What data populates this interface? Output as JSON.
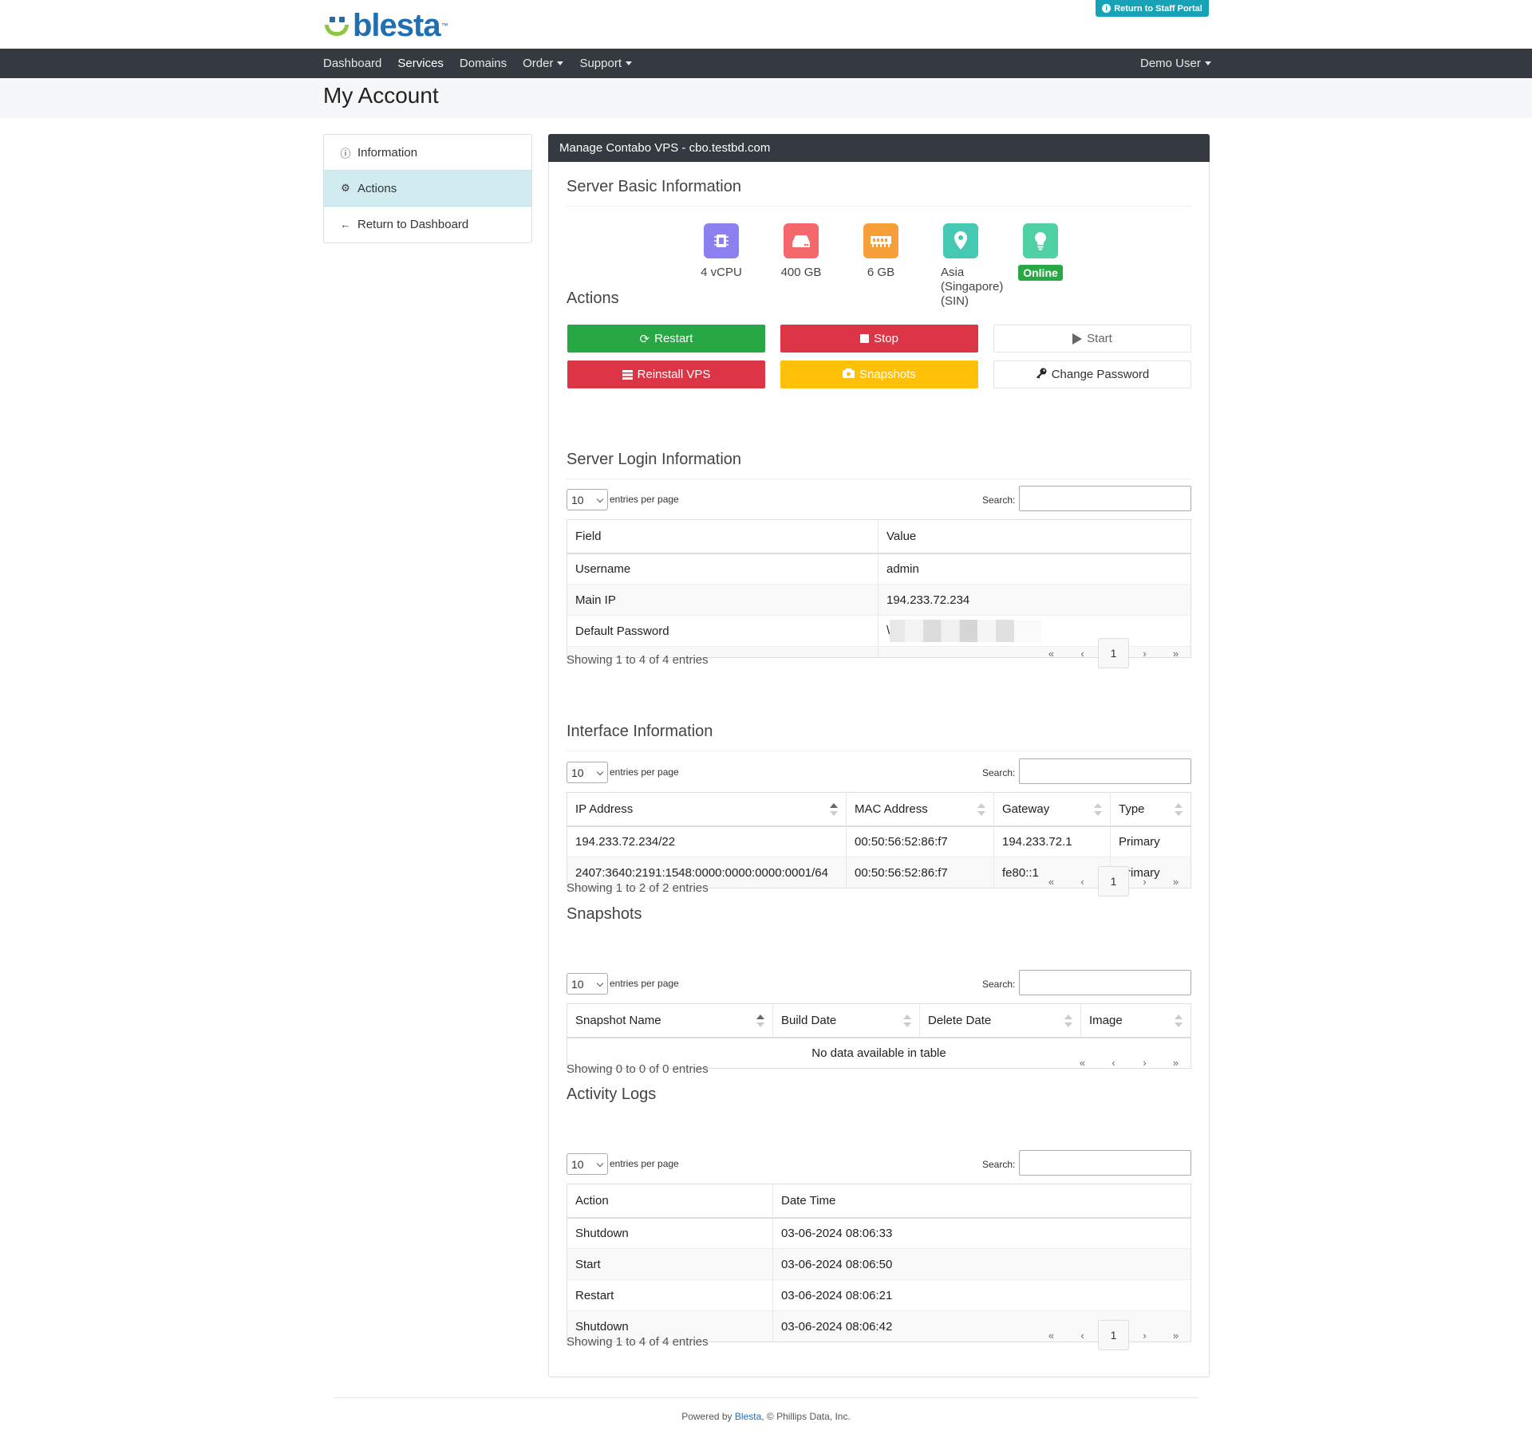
{
  "brand": {
    "name": "blesta",
    "tm": "™",
    "staff_portal": "Return to Staff Portal"
  },
  "nav": {
    "items": [
      {
        "label": "Dashboard",
        "dropdown": false,
        "active": false
      },
      {
        "label": "Services",
        "dropdown": false,
        "active": true
      },
      {
        "label": "Domains",
        "dropdown": false,
        "active": false
      },
      {
        "label": "Order",
        "dropdown": true,
        "active": false
      },
      {
        "label": "Support",
        "dropdown": true,
        "active": false
      }
    ],
    "user": "Demo User"
  },
  "page": {
    "title": "My Account"
  },
  "sidebar": {
    "items": [
      {
        "label": "Information",
        "icon": "info-icon"
      },
      {
        "label": "Actions",
        "icon": "gear-icon",
        "active": true
      },
      {
        "label": "Return to Dashboard",
        "icon": "arrow-left-icon"
      }
    ]
  },
  "panel": {
    "title": "Manage Contabo VPS - cbo.testbd.com"
  },
  "basic": {
    "title": "Server Basic Information",
    "specs": [
      {
        "label": "4 vCPU",
        "icon": "cpu-icon",
        "color": "#8c7ff0"
      },
      {
        "label": "400 GB",
        "icon": "disk-icon",
        "color": "#f4676b"
      },
      {
        "label": "6 GB",
        "icon": "memory-icon",
        "color": "#f7a03a"
      },
      {
        "label": "Asia (Singapore) (SIN)",
        "icon": "location-icon",
        "color": "#45c9b5"
      },
      {
        "label": "Online",
        "icon": "bulb-icon",
        "color": "#4fd1a4"
      }
    ]
  },
  "actions": {
    "title": "Actions",
    "restart": "Restart",
    "stop": "Stop",
    "start": "Start",
    "reinstall": "Reinstall VPS",
    "snapshots": "Snapshots",
    "change_password": "Change Password"
  },
  "dt": {
    "length": "10",
    "entries_per_page": "entries per page",
    "search": "Search:"
  },
  "pager": {
    "first": "«",
    "prev": "‹",
    "page": "1",
    "next": "›",
    "last": "»"
  },
  "login": {
    "title": "Server Login Information",
    "headers": [
      "Field",
      "Value"
    ],
    "rows": [
      [
        "Username",
        "admin"
      ],
      [
        "Main IP",
        "194.233.72.234"
      ],
      [
        "Default Password",
        "\\"
      ],
      [
        "",
        ""
      ]
    ],
    "info": "Showing 1 to 4 of 4 entries"
  },
  "interface": {
    "title": "Interface Information",
    "headers": [
      "IP Address",
      "MAC Address",
      "Gateway",
      "Type"
    ],
    "rows": [
      [
        "194.233.72.234/22",
        "00:50:56:52:86:f7",
        "194.233.72.1",
        "Primary"
      ],
      [
        "2407:3640:2191:1548:0000:0000:0000:0001/64",
        "00:50:56:52:86:f7",
        "fe80::1",
        "Primary"
      ]
    ],
    "info": "Showing 1 to 2 of 2 entries"
  },
  "snapshots": {
    "title": "Snapshots",
    "headers": [
      "Snapshot Name",
      "Build Date",
      "Delete Date",
      "Image"
    ],
    "empty": "No data available in table",
    "info": "Showing 0 to 0 of 0 entries"
  },
  "logs": {
    "title": "Activity Logs",
    "headers": [
      "Action",
      "Date Time"
    ],
    "rows": [
      [
        "Shutdown",
        "03-06-2024 08:06:33"
      ],
      [
        "Start",
        "03-06-2024 08:06:50"
      ],
      [
        "Restart",
        "03-06-2024 08:06:21"
      ],
      [
        "Shutdown",
        "03-06-2024 08:06:42"
      ]
    ],
    "info": "Showing 1 to 4 of 4 entries"
  },
  "footer": {
    "prefix": "Powered by ",
    "link": "Blesta",
    "suffix": ", © Phillips Data, Inc."
  }
}
